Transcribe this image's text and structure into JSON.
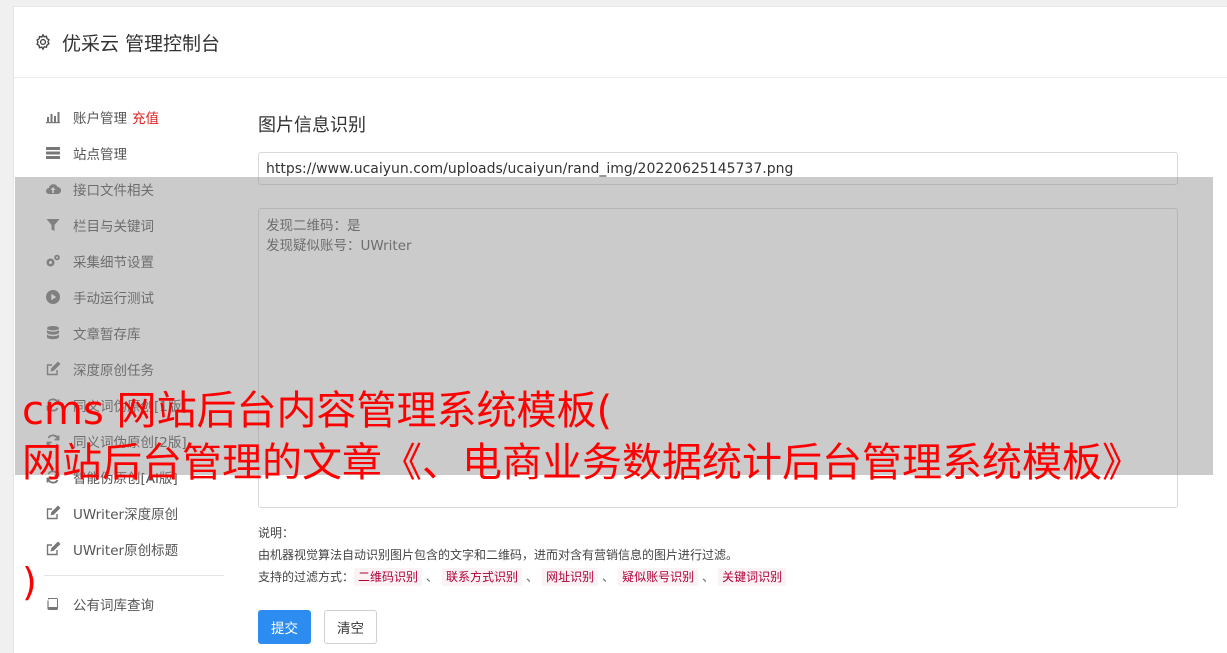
{
  "header": {
    "title": "优采云 管理控制台"
  },
  "sidebar": {
    "items": [
      {
        "label": "账户管理",
        "badge": "充值",
        "icon": "bar-chart-icon"
      },
      {
        "label": "站点管理",
        "icon": "server-icon"
      },
      {
        "label": "接口文件相关",
        "icon": "cloud-upload-icon"
      },
      {
        "label": "栏目与关键词",
        "icon": "filter-icon"
      },
      {
        "label": "采集细节设置",
        "icon": "gears-icon"
      },
      {
        "label": "手动运行测试",
        "icon": "play-circle-icon"
      },
      {
        "label": "文章暂存库",
        "icon": "database-icon"
      },
      {
        "label": "深度原创任务",
        "icon": "edit-icon"
      },
      {
        "label": "同义词伪原创[1版]",
        "icon": "refresh-icon"
      },
      {
        "label": "同义词伪原创[2版]",
        "icon": "refresh-icon"
      },
      {
        "label": "智能伪原创[AI版]",
        "icon": "refresh-icon"
      },
      {
        "label": "UWriter深度原创",
        "icon": "edit-icon"
      },
      {
        "label": "UWriter原创标题",
        "icon": "edit-icon"
      },
      {
        "label": "公有词库查询",
        "icon": "book-icon"
      }
    ]
  },
  "main": {
    "title": "图片信息识别",
    "url_value": "https://www.ucaiyun.com/uploads/ucaiyun/rand_img/20220625145737.png",
    "result_lines": [
      "发现二维码：是",
      "发现疑似账号：UWriter"
    ],
    "notes_label": "说明：",
    "notes_desc": "由机器视觉算法自动识别图片包含的文字和二维码，进而对含有营销信息的图片进行过滤。",
    "filters_label": "支持的过滤方式：",
    "filters": [
      "二维码识别",
      "联系方式识别",
      "网址识别",
      "疑似账号识别",
      "关键词识别"
    ],
    "filter_separator": "、",
    "submit_label": "提交",
    "clear_label": "清空"
  },
  "watermark": {
    "line1": "cms 网站后台内容管理系统模板(",
    "line2": "网站后台管理的文章《、电商业务数据统计后台管理系统模板》",
    "line3": ")"
  }
}
